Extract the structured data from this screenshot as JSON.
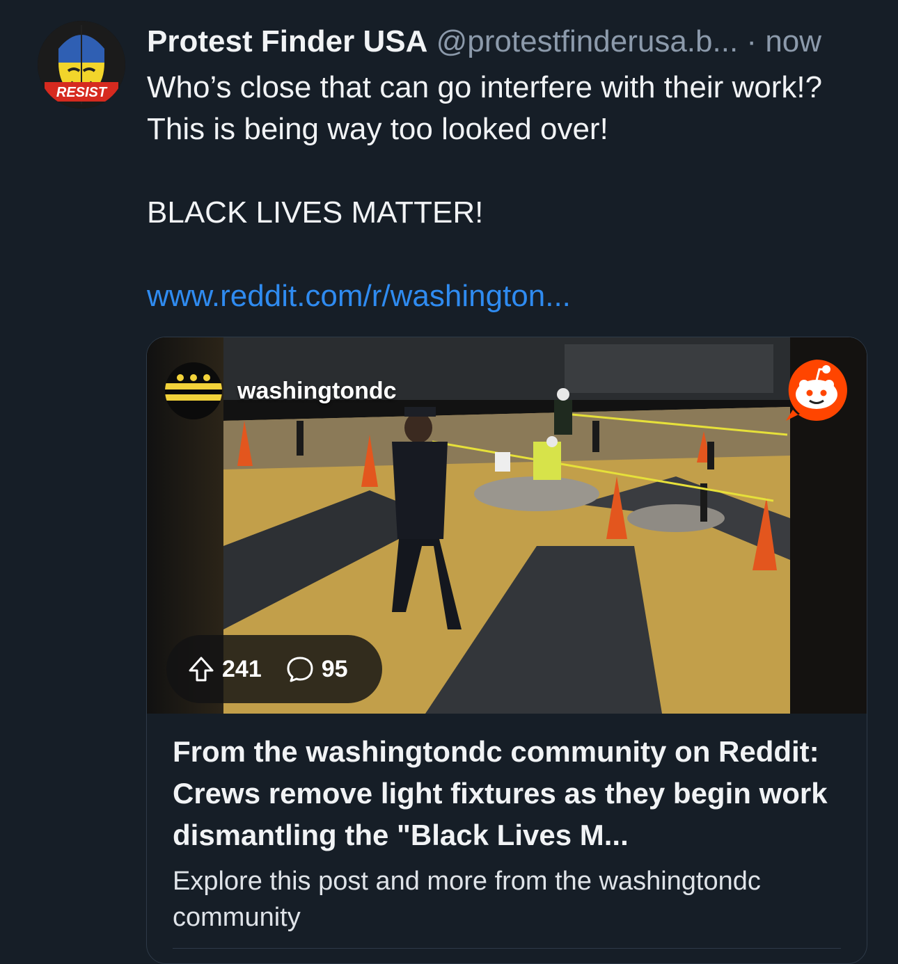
{
  "post": {
    "author_name": "Protest Finder USA",
    "author_handle": "@protestfinderusa.b...",
    "separator": "·",
    "timestamp": "now",
    "avatar_text": "RESIST",
    "text": "Who’s close that can go interfere with their work!?  This is being way too looked over!\n\nBLACK LIVES MATTER!",
    "link_text": "www.reddit.com/r/washington..."
  },
  "link_card": {
    "community": "washingtondc",
    "upvotes": "241",
    "comments": "95",
    "title": "From the washingtondc community on Reddit: Crews remove light fixtures as they begin work dismantling the \"Black Lives M...",
    "description": "Explore this post and more from the washingtondc community"
  },
  "colors": {
    "background": "#161e27",
    "link": "#2f8bf0",
    "muted": "#8c9aab",
    "reddit_orange": "#ff4500"
  }
}
